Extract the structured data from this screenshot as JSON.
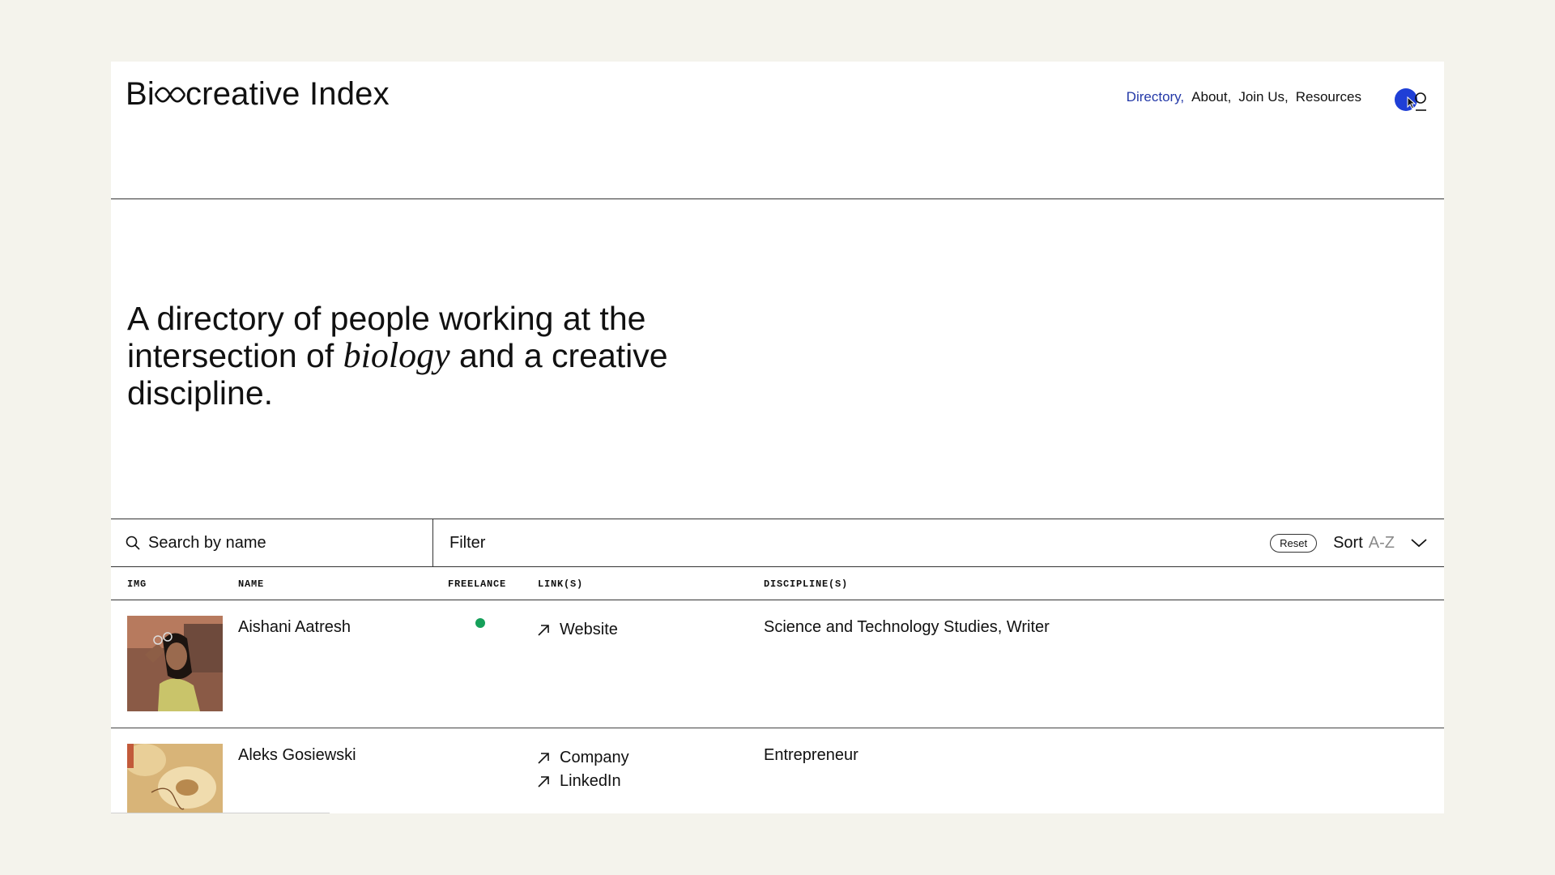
{
  "brand": {
    "logo_prefix": "Bi",
    "logo_suffix": "creative Index"
  },
  "nav": {
    "items": [
      {
        "label": "Directory,",
        "active": true
      },
      {
        "label": "About,",
        "active": false
      },
      {
        "label": "Join Us,",
        "active": false
      },
      {
        "label": "Resources",
        "active": false
      }
    ]
  },
  "hero": {
    "line_pre": "A directory of people working at the intersection of ",
    "emphasis": "biology",
    "line_post": " and a creative discipline."
  },
  "toolbar": {
    "search_placeholder": "Search by name",
    "filter_label": "Filter",
    "reset_label": "Reset",
    "sort_label": "Sort",
    "sort_value": "A-Z"
  },
  "table": {
    "headers": {
      "img": "IMG",
      "name": "NAME",
      "freelance": "FREELANCE",
      "links": "LINK(S)",
      "disciplines": "DISCIPLINE(S)"
    },
    "rows": [
      {
        "name": "Aishani Aatresh",
        "freelance": true,
        "links": [
          "Website"
        ],
        "disciplines": "Science and Technology Studies, Writer"
      },
      {
        "name": "Aleks Gosiewski",
        "freelance": false,
        "links": [
          "Company",
          "LinkedIn"
        ],
        "disciplines": "Entrepreneur"
      }
    ]
  },
  "colors": {
    "background": "#f4f3ec",
    "accent": "#2439a8",
    "toggle": "#1f3fd6",
    "freelance_dot": "#15a05a"
  }
}
